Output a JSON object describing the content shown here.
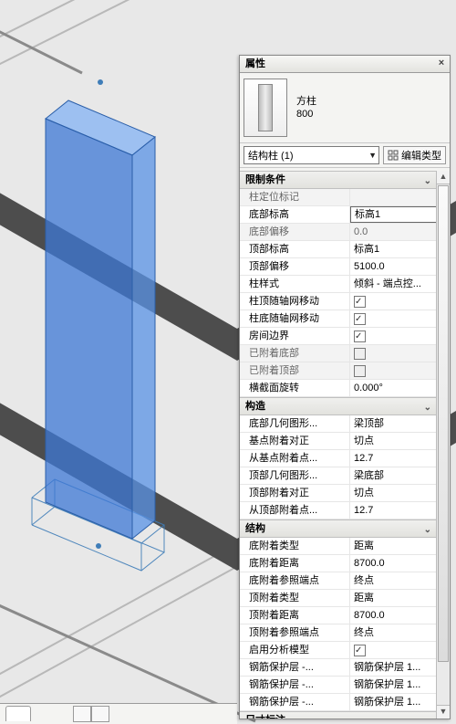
{
  "panel": {
    "title": "属性",
    "type_family": "方柱",
    "type_size": "800",
    "selector": "结构柱 (1)",
    "edit_type": "编辑类型"
  },
  "groups": [
    {
      "name": "限制条件",
      "rows": [
        {
          "k": "柱定位标记",
          "v": "",
          "ro": true
        },
        {
          "k": "底部标高",
          "v": "标高1",
          "sel": true
        },
        {
          "k": "底部偏移",
          "v": "0.0",
          "ro": true
        },
        {
          "k": "顶部标高",
          "v": "标高1"
        },
        {
          "k": "顶部偏移",
          "v": "5100.0"
        },
        {
          "k": "柱样式",
          "v": "倾斜 - 端点控..."
        },
        {
          "k": "柱顶随轴网移动",
          "v": "",
          "chk": "on"
        },
        {
          "k": "柱底随轴网移动",
          "v": "",
          "chk": "on"
        },
        {
          "k": "房间边界",
          "v": "",
          "chk": "on"
        },
        {
          "k": "已附着底部",
          "v": "",
          "ro": true,
          "chk": "dis"
        },
        {
          "k": "已附着顶部",
          "v": "",
          "ro": true,
          "chk": "dis"
        },
        {
          "k": "横截面旋转",
          "v": "0.000°"
        }
      ]
    },
    {
      "name": "构造",
      "rows": [
        {
          "k": "底部几何图形...",
          "v": "梁顶部"
        },
        {
          "k": "基点附着对正",
          "v": "切点"
        },
        {
          "k": "从基点附着点...",
          "v": "12.7"
        },
        {
          "k": "顶部几何图形...",
          "v": "梁底部"
        },
        {
          "k": "顶部附着对正",
          "v": "切点"
        },
        {
          "k": "从顶部附着点...",
          "v": "12.7"
        }
      ]
    },
    {
      "name": "结构",
      "rows": [
        {
          "k": "底附着类型",
          "v": "距离"
        },
        {
          "k": "底附着距离",
          "v": "8700.0"
        },
        {
          "k": "底附着参照端点",
          "v": "终点"
        },
        {
          "k": "顶附着类型",
          "v": "距离"
        },
        {
          "k": "顶附着距离",
          "v": "8700.0"
        },
        {
          "k": "顶附着参照端点",
          "v": "终点"
        },
        {
          "k": "启用分析模型",
          "v": "",
          "chk": "on"
        },
        {
          "k": "钢筋保护层 -...",
          "v": "钢筋保护层 1..."
        },
        {
          "k": "钢筋保护层 -...",
          "v": "钢筋保护层 1..."
        },
        {
          "k": "钢筋保护层 -...",
          "v": "钢筋保护层 1..."
        }
      ]
    },
    {
      "name": "尺寸标注",
      "rows": []
    }
  ]
}
